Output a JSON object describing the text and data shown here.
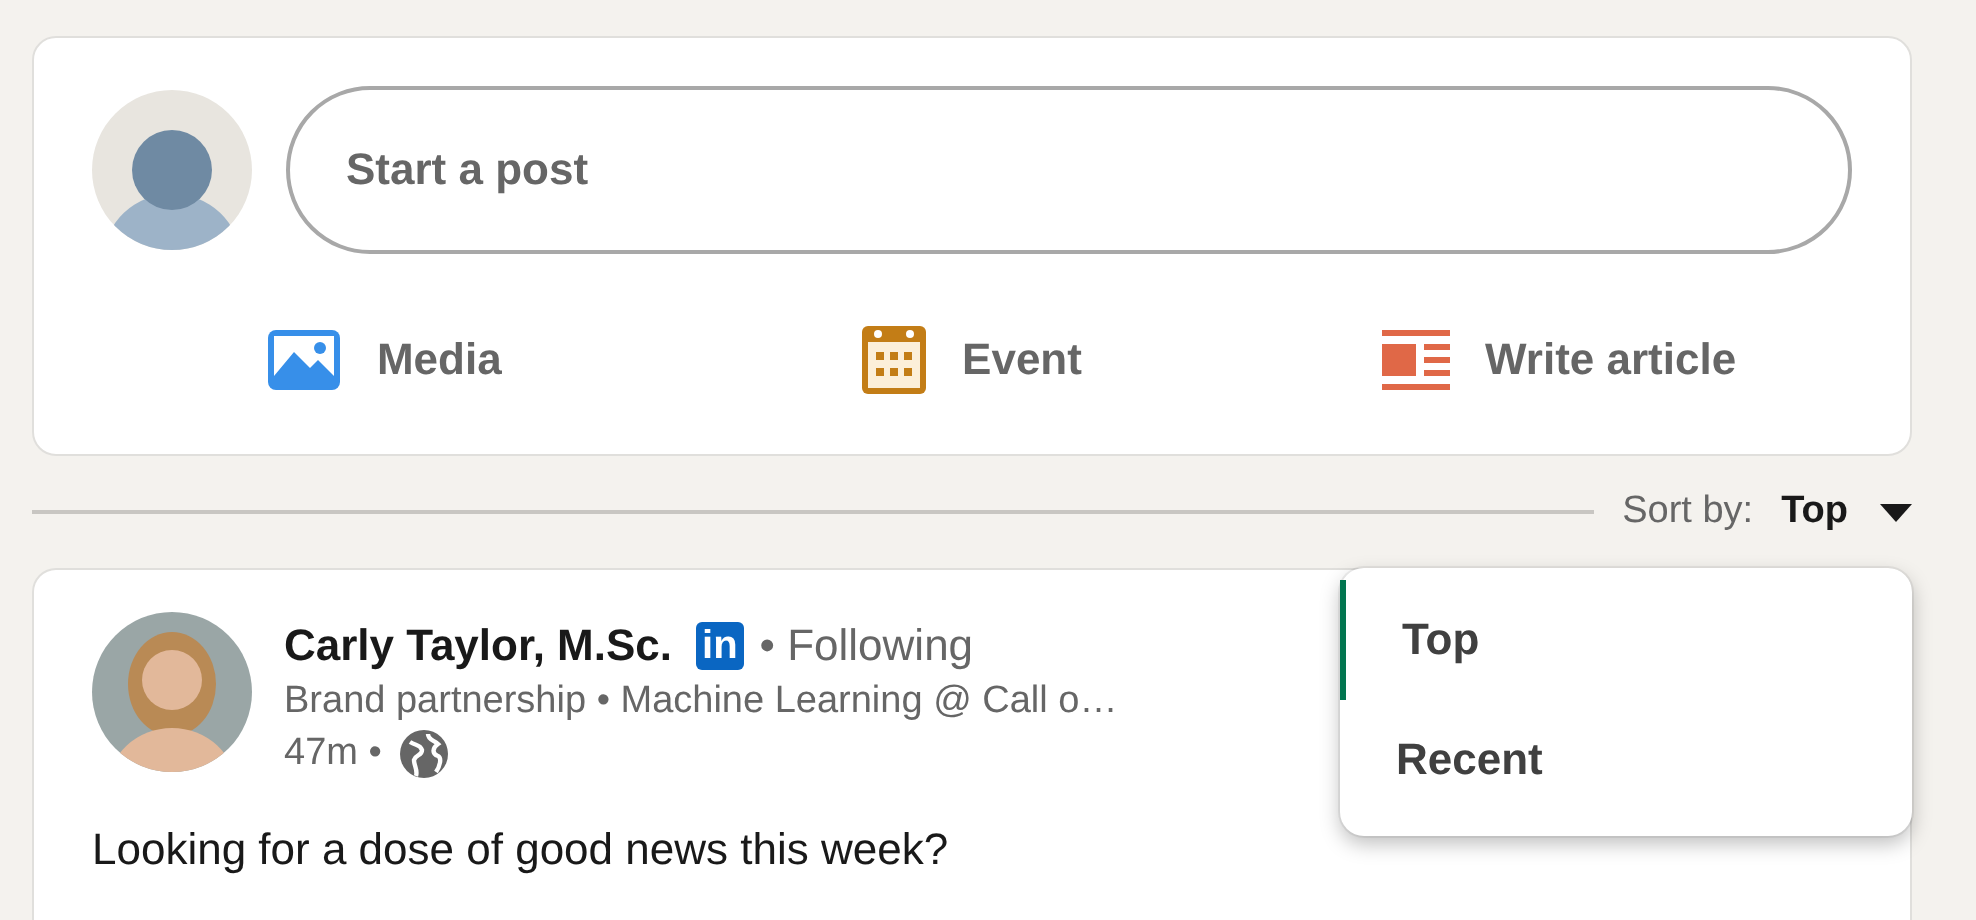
{
  "composer": {
    "placeholder": "Start a post",
    "actions": [
      {
        "label": "Media",
        "kind": "media"
      },
      {
        "label": "Event",
        "kind": "event"
      },
      {
        "label": "Write article",
        "kind": "article"
      }
    ]
  },
  "sort": {
    "label": "Sort by:",
    "value": "Top",
    "options": [
      {
        "label": "Top",
        "selected": true
      },
      {
        "label": "Recent",
        "selected": false
      }
    ]
  },
  "post": {
    "author": "Carly Taylor, M.Sc.",
    "badge": "in",
    "follow": "• Following",
    "subtitle": "Brand partnership • Machine Learning @ Call o…",
    "time": "47m •",
    "text": "Looking for a dose of good news this week?"
  }
}
